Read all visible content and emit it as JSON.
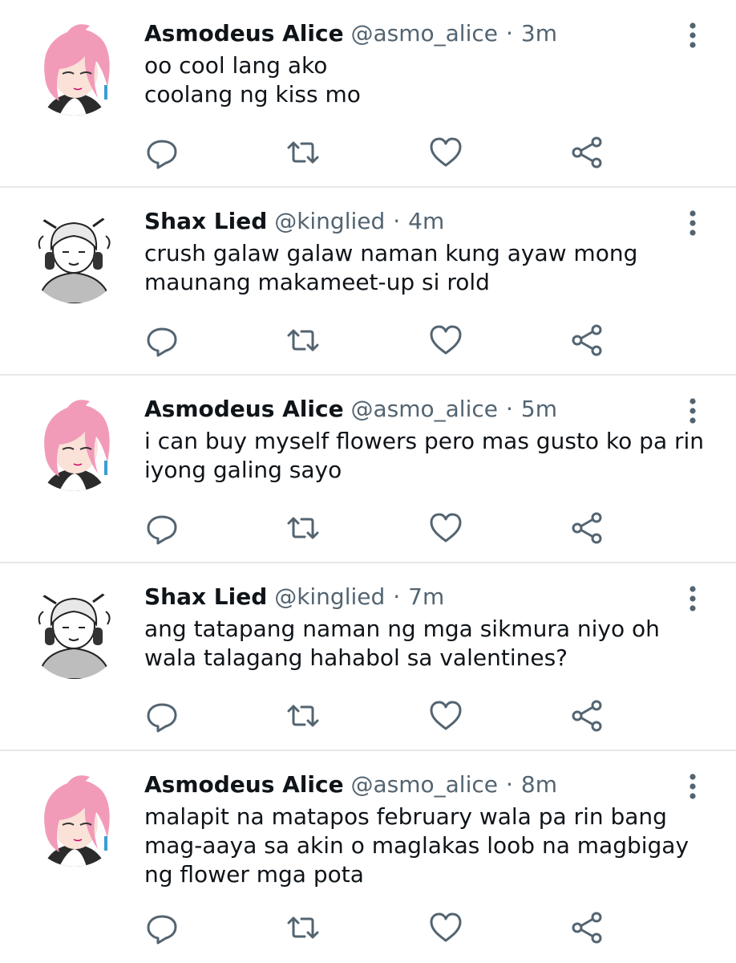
{
  "tweets": [
    {
      "name": "Asmodeus Alice",
      "handle": "@asmo_alice",
      "separator": "·",
      "time": "3m",
      "lines": [
        "oo cool lang ako",
        "coolang ng kiss mo"
      ],
      "avatar": "pink-haired-character-avatar"
    },
    {
      "name": "Shax Lied",
      "handle": "@kinglied",
      "separator": "·",
      "time": "4m",
      "lines": [
        "crush galaw galaw naman kung ayaw mong",
        "maunang makameet-up si rold"
      ],
      "avatar": "manga-character-headphones-avatar"
    },
    {
      "name": "Asmodeus Alice",
      "handle": "@asmo_alice",
      "separator": "·",
      "time": "5m",
      "lines": [
        "i can buy myself flowers pero mas gusto ko pa rin",
        "iyong galing sayo"
      ],
      "avatar": "pink-haired-character-avatar"
    },
    {
      "name": "Shax Lied",
      "handle": "@kinglied",
      "separator": "·",
      "time": "7m",
      "lines": [
        "ang tatapang naman ng mga sikmura niyo oh",
        "wala talagang hahabol sa valentines?"
      ],
      "avatar": "manga-character-headphones-avatar"
    },
    {
      "name": "Asmodeus Alice",
      "handle": "@asmo_alice",
      "separator": "·",
      "time": "8m",
      "lines": [
        "malapit na matapos february wala pa rin bang",
        "mag-aaya sa akin o maglakas loob na magbigay",
        "ng flower mga pota"
      ],
      "avatar": "pink-haired-character-avatar"
    }
  ],
  "icons": {
    "reply": "reply-icon",
    "retweet": "retweet-icon",
    "like": "like-icon",
    "share": "share-icon",
    "more": "more-options-icon"
  },
  "colors": {
    "text": "#0f1419",
    "secondary": "#536471",
    "divider": "#e6e8ea",
    "icon": "#536471"
  }
}
